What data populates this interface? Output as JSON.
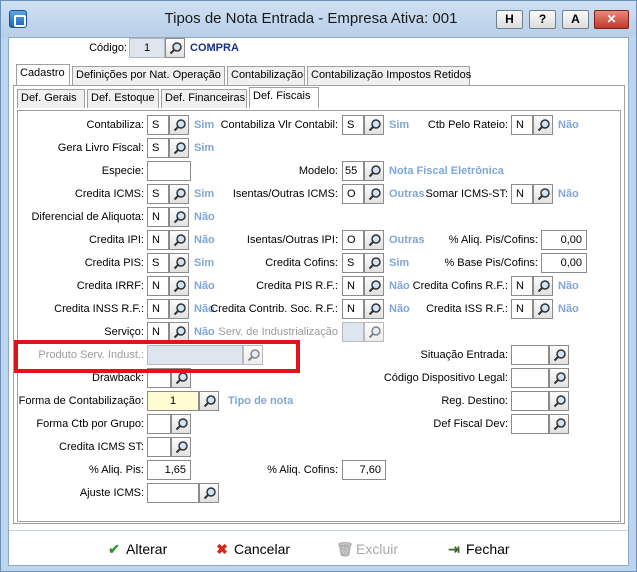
{
  "window": {
    "title": "Tipos de Nota Entrada - Empresa Ativa: 001",
    "buttons": [
      "H",
      "?",
      "A",
      "✕"
    ]
  },
  "codigo": {
    "label": "Código:",
    "value": "1",
    "desc": "COMPRA"
  },
  "tabs": [
    "Cadastro",
    "Definições por Nat. Operação",
    "Contabilização",
    "Contabilização Impostos Retidos"
  ],
  "subtabs": [
    "Def. Gerais",
    "Def. Estoque",
    "Def. Financeiras",
    "Def. Fiscais"
  ],
  "fields": {
    "contabiliza": {
      "label": "Contabiliza:",
      "value": "S",
      "desc": "Sim"
    },
    "contab_vlr": {
      "label": "Contabiliza Vlr Contabil:",
      "value": "S",
      "desc": "Sim"
    },
    "ctb_rateio": {
      "label": "Ctb Pelo Rateio:",
      "value": "N",
      "desc": "Não"
    },
    "gera_livro": {
      "label": "Gera Livro Fiscal:",
      "value": "S",
      "desc": "Sim"
    },
    "especie": {
      "label": "Especie:",
      "value": ""
    },
    "modelo": {
      "label": "Modelo:",
      "value": "55",
      "desc": "Nota Fiscal Eletrônica"
    },
    "credita_icms": {
      "label": "Credita ICMS:",
      "value": "S",
      "desc": "Sim"
    },
    "isentas_icms": {
      "label": "Isentas/Outras ICMS:",
      "value": "O",
      "desc": "Outras"
    },
    "somar_icms_st": {
      "label": "Somar ICMS-ST:",
      "value": "N",
      "desc": "Não"
    },
    "diferencial": {
      "label": "Diferencial de Aliquota:",
      "value": "N",
      "desc": "Não"
    },
    "credita_ipi": {
      "label": "Credita IPI:",
      "value": "N",
      "desc": "Não"
    },
    "isentas_ipi": {
      "label": "Isentas/Outras IPI:",
      "value": "O",
      "desc": "Outras"
    },
    "aliq_pis_cofins": {
      "label": "% Aliq. Pis/Cofins:",
      "value": "0,00"
    },
    "credita_pis": {
      "label": "Credita PIS:",
      "value": "S",
      "desc": "Sim"
    },
    "credita_cofins": {
      "label": "Credita Cofins:",
      "value": "S",
      "desc": "Sim"
    },
    "base_pis_cofins": {
      "label": "% Base Pis/Cofins:",
      "value": "0,00"
    },
    "credita_irrf": {
      "label": "Credita IRRF:",
      "value": "N",
      "desc": "Não"
    },
    "credita_pis_rf": {
      "label": "Credita PIS R.F.:",
      "value": "N",
      "desc": "Não"
    },
    "credita_cofins_rf": {
      "label": "Credita Cofins R.F.:",
      "value": "N",
      "desc": "Não"
    },
    "credita_inss_rf": {
      "label": "Credita INSS R.F.:",
      "value": "N",
      "desc": "Não"
    },
    "credita_contrib_rf": {
      "label": "Credita Contrib. Soc. R.F.:",
      "value": "N",
      "desc": "Não"
    },
    "credita_iss_rf": {
      "label": "Credita ISS R.F.:",
      "value": "N",
      "desc": "Não"
    },
    "servico": {
      "label": "Serviço:",
      "value": "N",
      "desc": "Não"
    },
    "serv_industrializacao": {
      "label": "Serv. de Industrialização",
      "value": ""
    },
    "produto_serv_indust": {
      "label": "Produto Serv. Indust.:",
      "value": ""
    },
    "situacao_entrada": {
      "label": "Situação Entrada:",
      "value": ""
    },
    "drawback": {
      "label": "Drawback:",
      "value": ""
    },
    "codigo_dispositivo": {
      "label": "Código Dispositivo Legal:",
      "value": ""
    },
    "forma_contabilizacao": {
      "label": "Forma de Contabilização:",
      "value": "1",
      "desc": "Tipo de nota"
    },
    "reg_destino": {
      "label": "Reg. Destino:",
      "value": ""
    },
    "forma_ctb_grupo": {
      "label": "Forma Ctb por Grupo:",
      "value": ""
    },
    "def_fiscal_dev": {
      "label": "Def Fiscal Dev:",
      "value": ""
    },
    "credita_icms_st": {
      "label": "Credita ICMS ST:",
      "value": ""
    },
    "aliq_pis": {
      "label": "% Aliq. Pis:",
      "value": "1,65"
    },
    "aliq_cofins": {
      "label": "% Aliq. Cofins:",
      "value": "7,60"
    },
    "ajuste_icms": {
      "label": "Ajuste ICMS:",
      "value": ""
    }
  },
  "footer": {
    "alterar": "Alterar",
    "cancelar": "Cancelar",
    "excluir": "Excluir",
    "fechar": "Fechar"
  },
  "colors": {
    "hint": "#7fa6d6",
    "code_desc": "#1b2f87",
    "highlight": "#e2121c",
    "window_bg": "#bcd4ec"
  },
  "icons": {
    "lookup": "magnifier-icon",
    "alterar": "check-icon",
    "cancelar": "x-icon",
    "excluir": "trash-icon",
    "fechar": "exit-door-icon"
  }
}
